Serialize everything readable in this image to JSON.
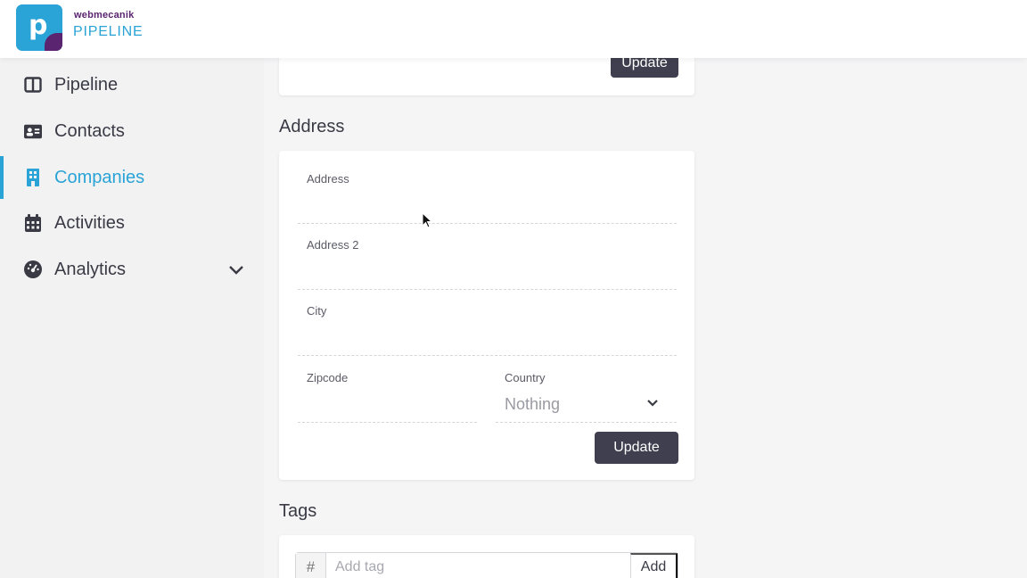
{
  "brand": {
    "top": "webmecanik",
    "bottom": "PIPELINE",
    "logo_letter": "p"
  },
  "colors": {
    "accent": "#2aa3d6",
    "brand_purple": "#5a2470",
    "button": "#3f3f4f"
  },
  "sidebar": {
    "items": [
      {
        "label": "Pipeline",
        "icon": "columns-icon",
        "active": false
      },
      {
        "label": "Contacts",
        "icon": "id-card-icon",
        "active": false
      },
      {
        "label": "Companies",
        "icon": "building-icon",
        "active": true
      },
      {
        "label": "Activities",
        "icon": "calendar-icon",
        "active": false
      },
      {
        "label": "Analytics",
        "icon": "gauge-icon",
        "active": false,
        "expandable": true
      }
    ]
  },
  "top_card": {
    "update_label": "Update"
  },
  "address": {
    "title": "Address",
    "fields": {
      "address": {
        "label": "Address",
        "value": ""
      },
      "address2": {
        "label": "Address 2",
        "value": ""
      },
      "city": {
        "label": "City",
        "value": ""
      },
      "zipcode": {
        "label": "Zipcode",
        "value": ""
      },
      "country": {
        "label": "Country",
        "value": "Nothing"
      }
    },
    "update_label": "Update"
  },
  "tags": {
    "title": "Tags",
    "prefix": "#",
    "placeholder": "Add tag",
    "add_label": "Add"
  }
}
